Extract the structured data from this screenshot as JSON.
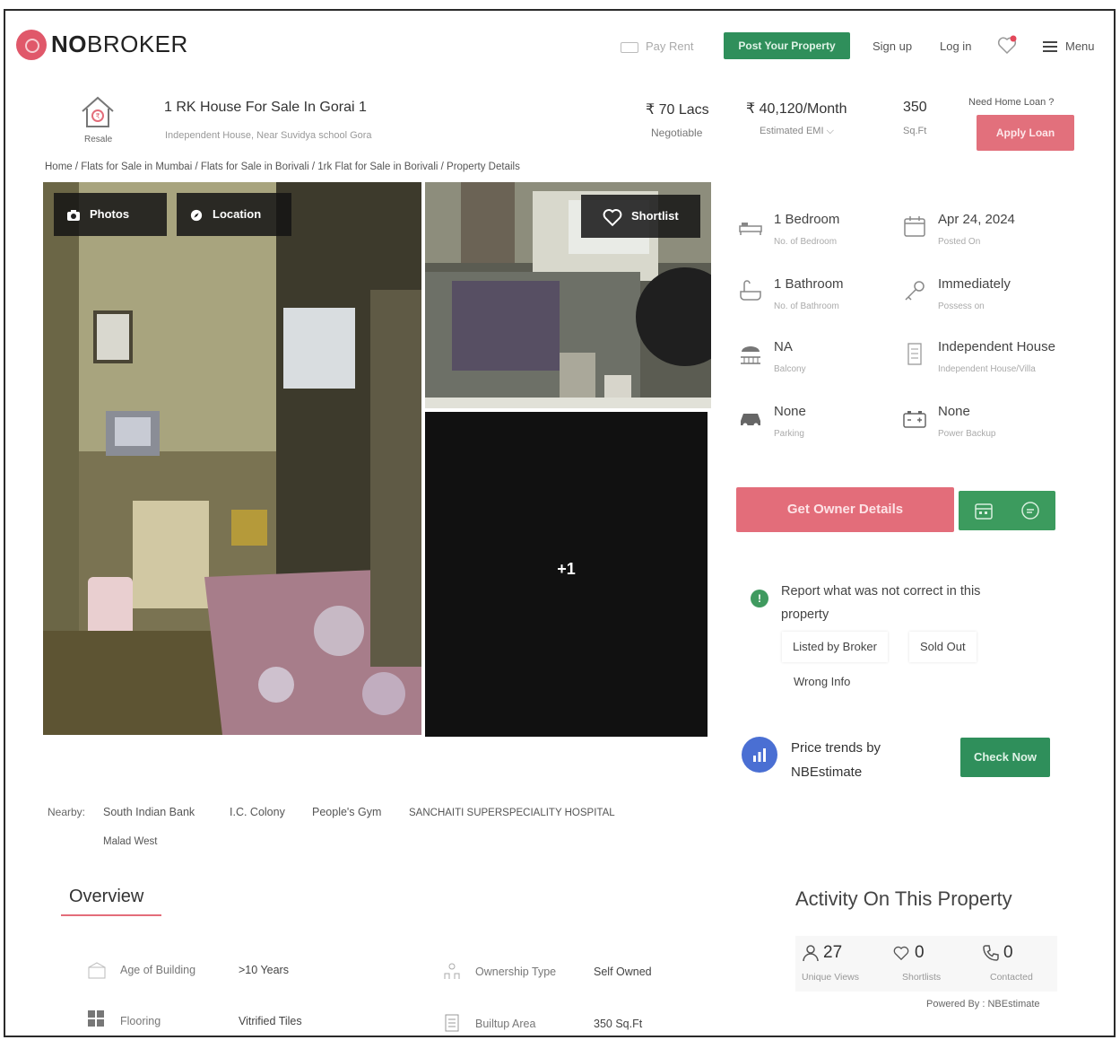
{
  "header": {
    "logo_bold": "NO",
    "logo_light": "BROKER",
    "pay_rent": "Pay Rent",
    "post_property": "Post Your Property",
    "sign_up": "Sign up",
    "log_in": "Log in",
    "menu": "Menu"
  },
  "listing": {
    "badge": "Resale",
    "title": "1 RK House For Sale In Gorai 1",
    "subtitle": "Independent House, Near Suvidya school Gora",
    "price": "₹ 70 Lacs",
    "price_note": "Negotiable",
    "emi": "₹ 40,120/Month",
    "emi_label": "Estimated EMI",
    "area": "350",
    "area_unit": "Sq.Ft",
    "loan_question": "Need Home Loan ?",
    "apply_loan": "Apply Loan"
  },
  "breadcrumb": "Home / Flats for Sale in Mumbai / Flats for Sale in Borivali / 1rk Flat for Sale in Borivali / Property Details",
  "gallery": {
    "photos": "Photos",
    "location": "Location",
    "shortlist": "Shortlist",
    "more": "+1"
  },
  "features": [
    {
      "value": "1 Bedroom",
      "label": "No. of Bedroom",
      "icon": "bed-icon"
    },
    {
      "value": "Apr 24, 2024",
      "label": "Posted On",
      "icon": "calendar-icon"
    },
    {
      "value": "1 Bathroom",
      "label": "No. of Bathroom",
      "icon": "bath-icon"
    },
    {
      "value": "Immediately",
      "label": "Possess on",
      "icon": "key-icon"
    },
    {
      "value": "NA",
      "label": "Balcony",
      "icon": "balcony-icon"
    },
    {
      "value": "Independent House",
      "label": "Independent House/Villa",
      "icon": "building-icon"
    },
    {
      "value": "None",
      "label": "Parking",
      "icon": "car-icon"
    },
    {
      "value": "None",
      "label": "Power Backup",
      "icon": "battery-icon"
    }
  ],
  "owner": {
    "button": "Get Owner Details"
  },
  "report": {
    "text": "Report what was not correct in this property",
    "chip1": "Listed by Broker",
    "chip2": "Sold Out",
    "chip3": "Wrong Info"
  },
  "price_trends": {
    "line1": "Price trends by",
    "line2": "NBEstimate",
    "button": "Check Now"
  },
  "nearby": {
    "label": "Nearby:",
    "items": [
      "South Indian Bank",
      "I.C. Colony",
      "People's Gym",
      "SANCHAITI SUPERSPECIALITY HOSPITAL",
      "Malad West"
    ]
  },
  "overview": {
    "title": "Overview",
    "rows": [
      {
        "label": "Age of Building",
        "value": ">10 Years"
      },
      {
        "label": "Ownership Type",
        "value": "Self Owned"
      },
      {
        "label": "Flooring",
        "value": "Vitrified Tiles"
      },
      {
        "label": "Builtup Area",
        "value": "350 Sq.Ft"
      }
    ]
  },
  "activity": {
    "title": "Activity On This Property",
    "views": "27",
    "views_label": "Unique Views",
    "shortlists": "0",
    "shortlists_label": "Shortlists",
    "contacted": "0",
    "contacted_label": "Contacted",
    "powered": "Powered By : NBEstimate"
  },
  "colors": {
    "brand_red": "#e36d7a",
    "brand_green": "#2f8f5b",
    "accent_blue": "#4a6fd3"
  }
}
